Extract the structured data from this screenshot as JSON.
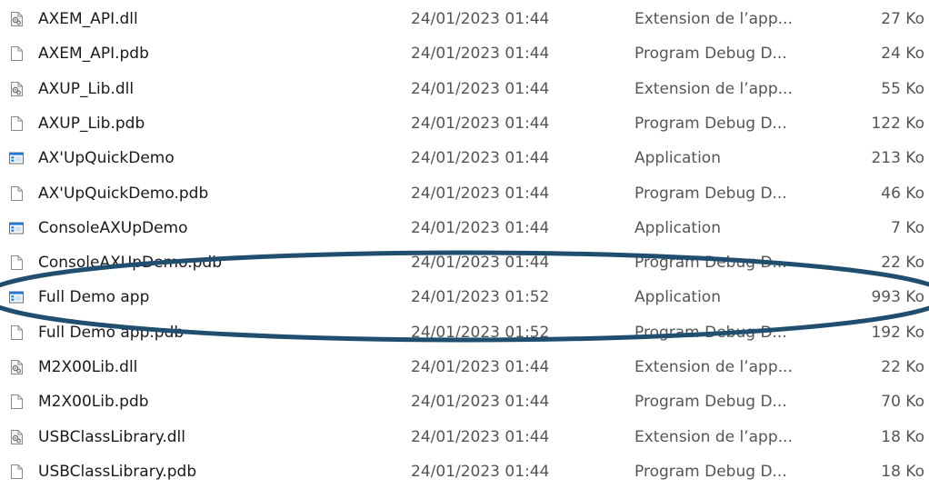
{
  "files": [
    {
      "name": "AXEM_API.dll",
      "date": "24/01/2023 01:44",
      "type": "Extension de l’app...",
      "size": "27 Ko",
      "icon": "dll-file-icon"
    },
    {
      "name": "AXEM_API.pdb",
      "date": "24/01/2023 01:44",
      "type": "Program Debug D...",
      "size": "24 Ko",
      "icon": "blank-file-icon"
    },
    {
      "name": "AXUP_Lib.dll",
      "date": "24/01/2023 01:44",
      "type": "Extension de l’app...",
      "size": "55 Ko",
      "icon": "dll-file-icon"
    },
    {
      "name": "AXUP_Lib.pdb",
      "date": "24/01/2023 01:44",
      "type": "Program Debug D...",
      "size": "122 Ko",
      "icon": "blank-file-icon"
    },
    {
      "name": "AX'UpQuickDemo",
      "date": "24/01/2023 01:44",
      "type": "Application",
      "size": "213 Ko",
      "icon": "application-icon"
    },
    {
      "name": "AX'UpQuickDemo.pdb",
      "date": "24/01/2023 01:44",
      "type": "Program Debug D...",
      "size": "46 Ko",
      "icon": "blank-file-icon"
    },
    {
      "name": "ConsoleAXUpDemo",
      "date": "24/01/2023 01:44",
      "type": "Application",
      "size": "7 Ko",
      "icon": "application-icon"
    },
    {
      "name": "ConsoleAXUpDemo.pdb",
      "date": "24/01/2023 01:44",
      "type": "Program Debug D...",
      "size": "22 Ko",
      "icon": "blank-file-icon"
    },
    {
      "name": "Full Demo app",
      "date": "24/01/2023 01:52",
      "type": "Application",
      "size": "993 Ko",
      "icon": "application-icon"
    },
    {
      "name": "Full Demo app.pdb",
      "date": "24/01/2023 01:52",
      "type": "Program Debug D...",
      "size": "192 Ko",
      "icon": "blank-file-icon"
    },
    {
      "name": "M2X00Lib.dll",
      "date": "24/01/2023 01:44",
      "type": "Extension de l’app...",
      "size": "22 Ko",
      "icon": "dll-file-icon"
    },
    {
      "name": "M2X00Lib.pdb",
      "date": "24/01/2023 01:44",
      "type": "Program Debug D...",
      "size": "70 Ko",
      "icon": "blank-file-icon"
    },
    {
      "name": "USBClassLibrary.dll",
      "date": "24/01/2023 01:44",
      "type": "Extension de l’app...",
      "size": "18 Ko",
      "icon": "dll-file-icon"
    },
    {
      "name": "USBClassLibrary.pdb",
      "date": "24/01/2023 01:44",
      "type": "Program Debug D...",
      "size": "18 Ko",
      "icon": "blank-file-icon"
    }
  ],
  "colors": {
    "highlight_ellipse": "#1f4e6e",
    "app_icon_accent": "#1e78d7",
    "text_primary": "#1a1a1a",
    "text_secondary": "#555555"
  }
}
